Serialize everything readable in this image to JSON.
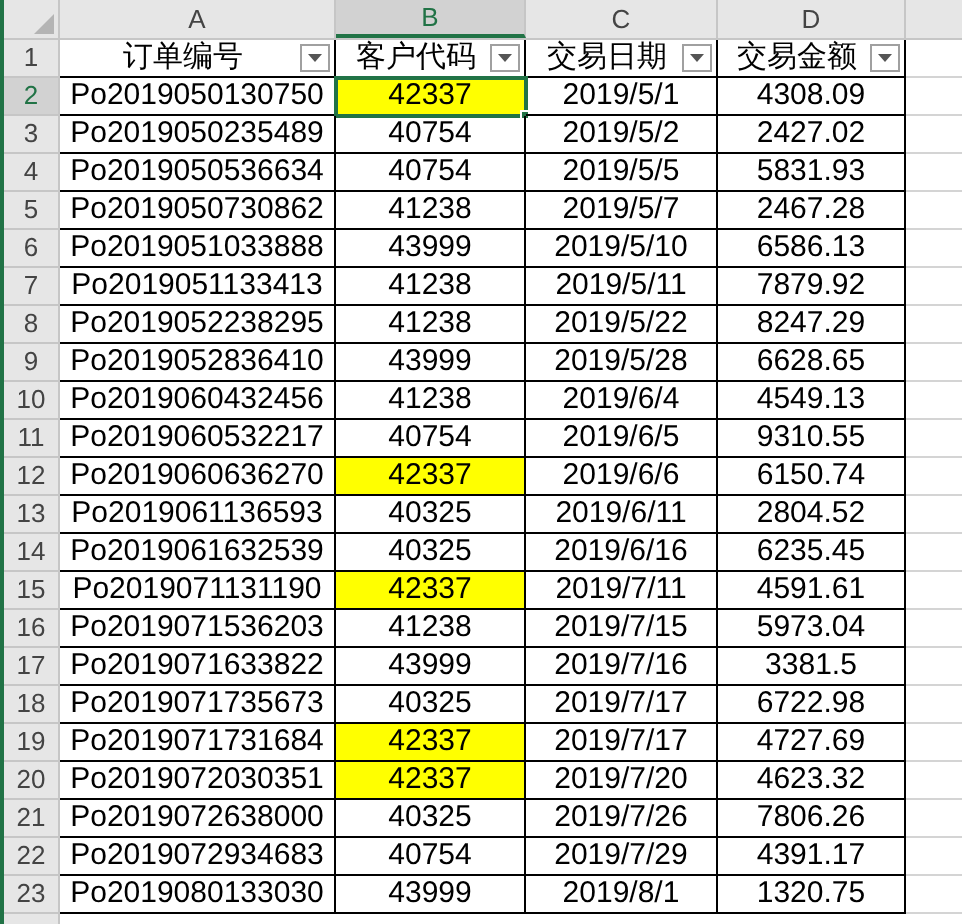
{
  "columns": [
    {
      "letter": "A",
      "selected": false
    },
    {
      "letter": "B",
      "selected": true
    },
    {
      "letter": "C",
      "selected": false
    },
    {
      "letter": "D",
      "selected": false
    }
  ],
  "header_row": {
    "number": "1",
    "cells": [
      "订单编号",
      "客户代码",
      "交易日期",
      "交易金额"
    ]
  },
  "rows": [
    {
      "number": "2",
      "selected": true,
      "highlighted": true,
      "cells": [
        "Po2019050130750",
        "42337",
        "2019/5/1",
        "4308.09"
      ]
    },
    {
      "number": "3",
      "selected": false,
      "highlighted": false,
      "cells": [
        "Po2019050235489",
        "40754",
        "2019/5/2",
        "2427.02"
      ]
    },
    {
      "number": "4",
      "selected": false,
      "highlighted": false,
      "cells": [
        "Po2019050536634",
        "40754",
        "2019/5/5",
        "5831.93"
      ]
    },
    {
      "number": "5",
      "selected": false,
      "highlighted": false,
      "cells": [
        "Po2019050730862",
        "41238",
        "2019/5/7",
        "2467.28"
      ]
    },
    {
      "number": "6",
      "selected": false,
      "highlighted": false,
      "cells": [
        "Po2019051033888",
        "43999",
        "2019/5/10",
        "6586.13"
      ]
    },
    {
      "number": "7",
      "selected": false,
      "highlighted": false,
      "cells": [
        "Po2019051133413",
        "41238",
        "2019/5/11",
        "7879.92"
      ]
    },
    {
      "number": "8",
      "selected": false,
      "highlighted": false,
      "cells": [
        "Po2019052238295",
        "41238",
        "2019/5/22",
        "8247.29"
      ]
    },
    {
      "number": "9",
      "selected": false,
      "highlighted": false,
      "cells": [
        "Po2019052836410",
        "43999",
        "2019/5/28",
        "6628.65"
      ]
    },
    {
      "number": "10",
      "selected": false,
      "highlighted": false,
      "cells": [
        "Po2019060432456",
        "41238",
        "2019/6/4",
        "4549.13"
      ]
    },
    {
      "number": "11",
      "selected": false,
      "highlighted": false,
      "cells": [
        "Po2019060532217",
        "40754",
        "2019/6/5",
        "9310.55"
      ]
    },
    {
      "number": "12",
      "selected": false,
      "highlighted": true,
      "cells": [
        "Po2019060636270",
        "42337",
        "2019/6/6",
        "6150.74"
      ]
    },
    {
      "number": "13",
      "selected": false,
      "highlighted": false,
      "cells": [
        "Po2019061136593",
        "40325",
        "2019/6/11",
        "2804.52"
      ]
    },
    {
      "number": "14",
      "selected": false,
      "highlighted": false,
      "cells": [
        "Po2019061632539",
        "40325",
        "2019/6/16",
        "6235.45"
      ]
    },
    {
      "number": "15",
      "selected": false,
      "highlighted": true,
      "cells": [
        "Po2019071131190",
        "42337",
        "2019/7/11",
        "4591.61"
      ]
    },
    {
      "number": "16",
      "selected": false,
      "highlighted": false,
      "cells": [
        "Po2019071536203",
        "41238",
        "2019/7/15",
        "5973.04"
      ]
    },
    {
      "number": "17",
      "selected": false,
      "highlighted": false,
      "cells": [
        "Po2019071633822",
        "43999",
        "2019/7/16",
        "3381.5"
      ]
    },
    {
      "number": "18",
      "selected": false,
      "highlighted": false,
      "cells": [
        "Po2019071735673",
        "40325",
        "2019/7/17",
        "6722.98"
      ]
    },
    {
      "number": "19",
      "selected": false,
      "highlighted": true,
      "cells": [
        "Po2019071731684",
        "42337",
        "2019/7/17",
        "4727.69"
      ]
    },
    {
      "number": "20",
      "selected": false,
      "highlighted": true,
      "cells": [
        "Po2019072030351",
        "42337",
        "2019/7/20",
        "4623.32"
      ]
    },
    {
      "number": "21",
      "selected": false,
      "highlighted": false,
      "cells": [
        "Po2019072638000",
        "40325",
        "2019/7/26",
        "7806.26"
      ]
    },
    {
      "number": "22",
      "selected": false,
      "highlighted": false,
      "cells": [
        "Po2019072934683",
        "40754",
        "2019/7/29",
        "4391.17"
      ]
    },
    {
      "number": "23",
      "selected": false,
      "highlighted": false,
      "cells": [
        "Po2019080133030",
        "43999",
        "2019/8/1",
        "1320.75"
      ]
    }
  ]
}
